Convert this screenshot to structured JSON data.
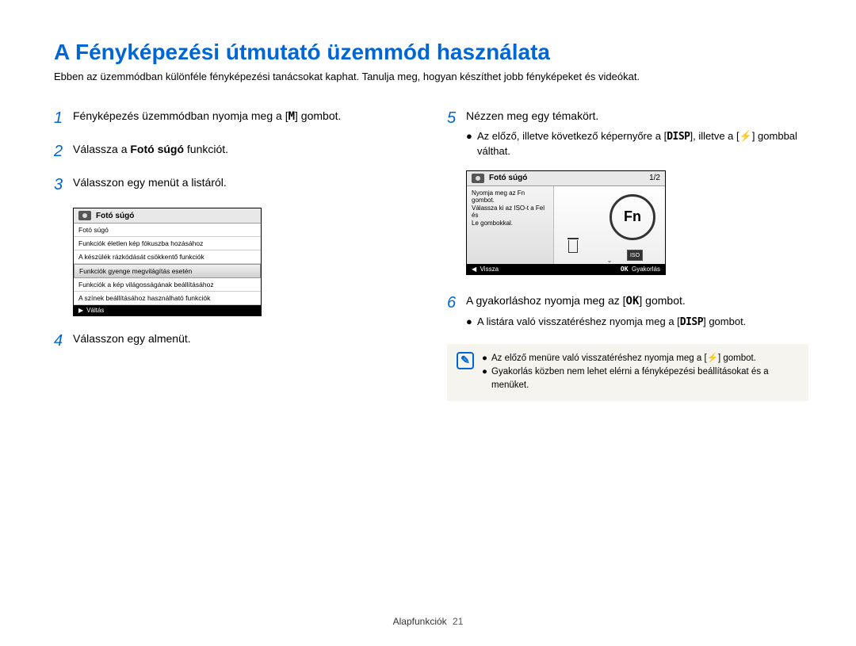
{
  "title": "A Fényképezési útmutató üzemmód használata",
  "intro": "Ebben az üzemmódban különféle fényképezési tanácsokat kaphat. Tanulja meg, hogyan készíthet jobb fényképeket és videókat.",
  "steps": {
    "s1": {
      "num": "1",
      "text_a": "Fényképezés üzemmódban nyomja meg a [",
      "icon": "M",
      "text_b": "] gombot."
    },
    "s2": {
      "num": "2",
      "text_a": "Válassza a ",
      "bold": "Fotó súgó",
      "text_b": " funkciót."
    },
    "s3": {
      "num": "3",
      "text": "Válasszon egy menüt a listáról."
    },
    "s4": {
      "num": "4",
      "text": "Válasszon egy almenüt."
    },
    "s5": {
      "num": "5",
      "text": "Nézzen meg egy témakört.",
      "sub_a": "Az előző, illetve következő képernyőre a [",
      "disp": "DISP",
      "sub_b": "], illetve a [",
      "flash": "⚡",
      "sub_c": "] gombbal válthat."
    },
    "s6": {
      "num": "6",
      "text_a": "A gyakorláshoz nyomja meg az [",
      "ok": "OK",
      "text_b": "] gombot.",
      "sub_a": "A listára való visszatéréshez nyomja meg a [",
      "disp": "DISP",
      "sub_b": "] gombot."
    }
  },
  "screen1": {
    "title": "Fotó súgó",
    "rows": [
      "Fotó súgó",
      "Funkciók életlen kép fókuszba hozásához",
      "A készülék rázkódását csökkentő funkciók",
      "Funkciók gyenge megvilágítás esetén",
      "Funkciók a kép világosságának beállításához",
      "A színek beállításához használható funkciók"
    ],
    "selected_index": 3,
    "footer": "Váltás"
  },
  "screen2": {
    "title": "Fotó súgó",
    "page": "1/2",
    "body_l1": "Nyomja meg az Fn gombot.",
    "body_l2": "Válassza ki az ISO-t a Fel és",
    "body_l3": "Le gombokkal.",
    "fn": "Fn",
    "iso": "ISO",
    "footer_left": "Vissza",
    "footer_right": "Gyakorlás",
    "footer_ok": "OK"
  },
  "note": {
    "l1_a": "Az előző menüre való visszatéréshez nyomja meg a [",
    "l1_flash": "⚡",
    "l1_b": "] gombot.",
    "l2": "Gyakorlás közben nem lehet elérni a fényképezési beállításokat és a menüket."
  },
  "footer": {
    "label": "Alapfunkciók",
    "page": "21"
  }
}
